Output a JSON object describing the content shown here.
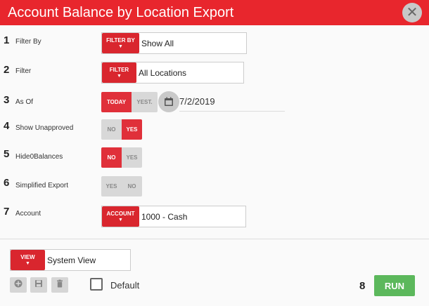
{
  "window": {
    "title": "Account Balance by Location Export",
    "close_symbol": "✕"
  },
  "rows": [
    {
      "num": "1",
      "label": "Filter By",
      "button": "FILTER BY",
      "value": "Show All"
    },
    {
      "num": "2",
      "label": "Filter",
      "button": "FILTER",
      "value": "All Locations"
    },
    {
      "num": "3",
      "label": "As Of",
      "today": "TODAY",
      "yest": "YEST.",
      "date": "7/2/2019"
    },
    {
      "num": "4",
      "label": "Show Unapproved",
      "opt_a": "NO",
      "opt_b": "YES"
    },
    {
      "num": "5",
      "label": "Hide0Balances",
      "opt_a": "NO",
      "opt_b": "YES"
    },
    {
      "num": "6",
      "label": "Simplified Export",
      "opt_a": "YES",
      "opt_b": "NO"
    },
    {
      "num": "7",
      "label": "Account",
      "button": "ACCOUNT",
      "value": "1000 - Cash"
    }
  ],
  "dropdown_arrow": "▼",
  "footer": {
    "view_button": "VIEW",
    "view_value": "System View",
    "default_label": "Default",
    "run_num": "8",
    "run_label": "RUN"
  },
  "colors": {
    "accent": "#e8262d",
    "run": "#5cb85c"
  }
}
